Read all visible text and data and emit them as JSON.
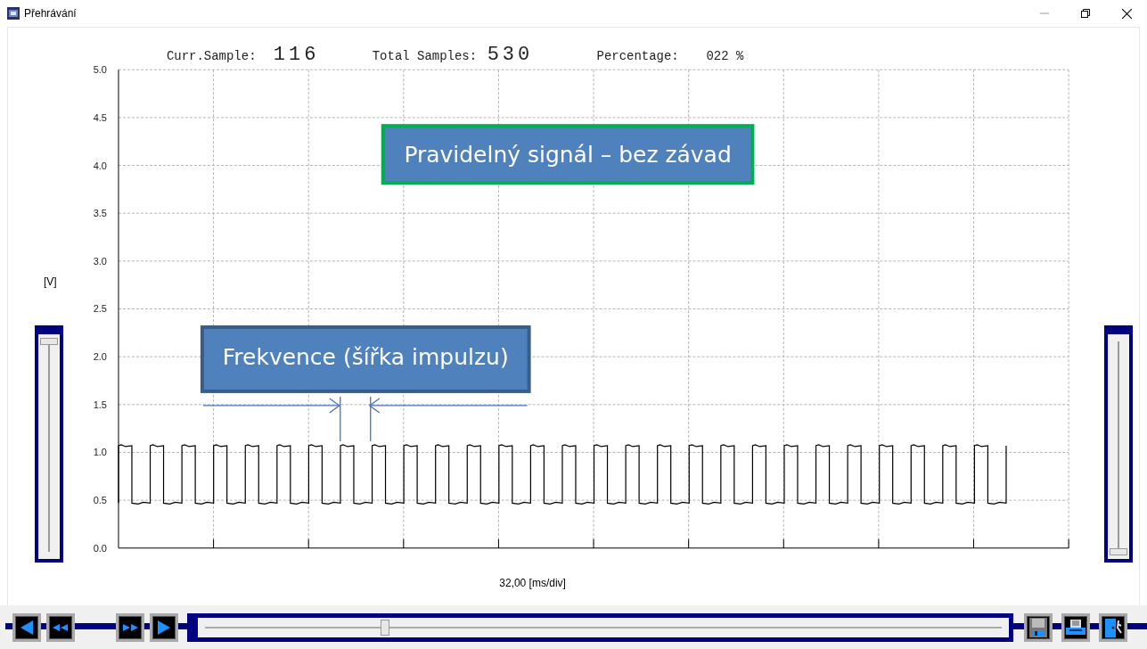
{
  "window": {
    "title": "Přehrávání"
  },
  "readout": [
    {
      "label": "Curr.Sample:",
      "value": "116",
      "kind": "big"
    },
    {
      "label": "Total Samples:",
      "value": "530",
      "kind": "big"
    },
    {
      "label": "Percentage:",
      "value": "022 %",
      "kind": "small"
    }
  ],
  "chart": {
    "y_unit": "[V]",
    "y_ticks": [
      "5.0",
      "4.5",
      "4.0",
      "3.5",
      "3.0",
      "2.5",
      "2.0",
      "1.5",
      "1.0",
      "0.5",
      "0.0"
    ],
    "x_label": "32,00 [ms/div]"
  },
  "annotations": [
    {
      "text": "Pravidelný signál – bez závad",
      "color": "#00b050",
      "kind": "note"
    },
    {
      "text": "Frekvence (šířka impulzu)",
      "color": "#385d8a",
      "kind": "width"
    }
  ],
  "left_slider": {
    "level": 1
  },
  "right_slider": {
    "level": 0
  },
  "transport_left": [
    {
      "kind": "prev"
    },
    {
      "kind": "rewind"
    },
    {
      "kind": "forward"
    },
    {
      "kind": "next"
    }
  ],
  "playback_slider": {
    "level": 0.23
  },
  "transport_right": [
    {
      "kind": "save"
    },
    {
      "kind": "print"
    },
    {
      "kind": "exit"
    }
  ]
}
